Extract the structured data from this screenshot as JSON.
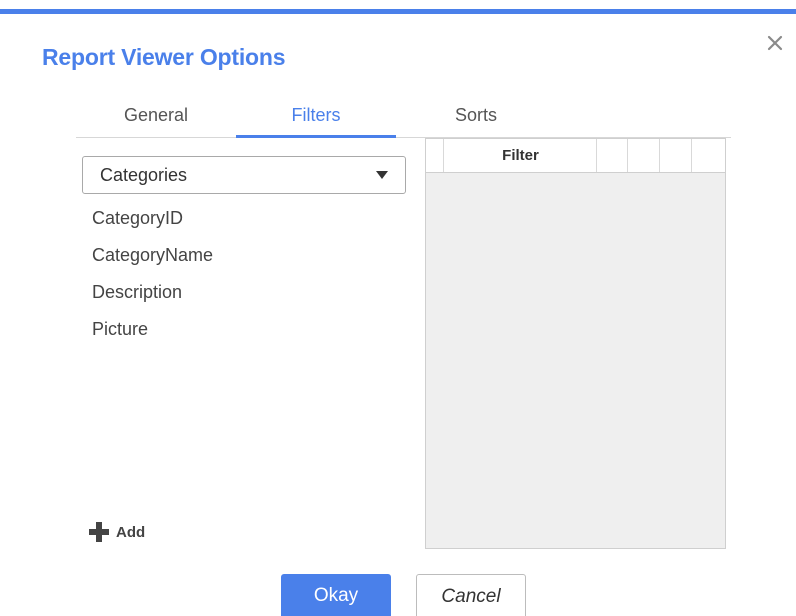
{
  "dialog": {
    "title": "Report Viewer Options",
    "accent_color": "#4a80ea",
    "close_icon": "close-icon"
  },
  "tabs": [
    {
      "label": "General",
      "active": false
    },
    {
      "label": "Filters",
      "active": true
    },
    {
      "label": "Sorts",
      "active": false
    }
  ],
  "table_select": {
    "value": "Categories",
    "icon": "caret-down-icon"
  },
  "fields": [
    {
      "label": "CategoryID"
    },
    {
      "label": "CategoryName"
    },
    {
      "label": "Description"
    },
    {
      "label": "Picture"
    }
  ],
  "add_button": {
    "label": "Add",
    "icon": "plus-icon"
  },
  "filter_grid": {
    "columns": [
      "",
      "Filter",
      "",
      "",
      "",
      ""
    ],
    "rows": []
  },
  "footer": {
    "okay_label": "Okay",
    "cancel_label": "Cancel"
  }
}
